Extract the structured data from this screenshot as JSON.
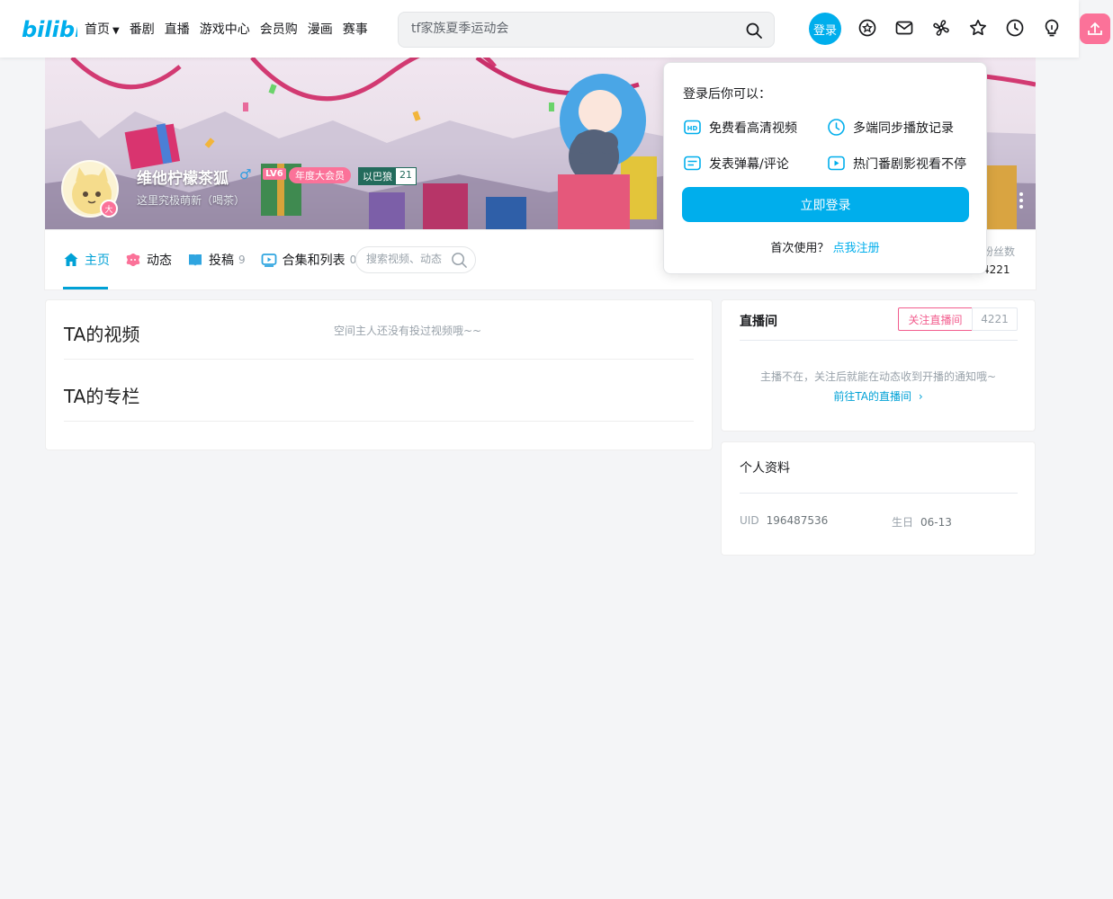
{
  "header": {
    "logo_text": "bilibili",
    "nav": [
      "首页",
      "番剧",
      "直播",
      "游戏中心",
      "会员购",
      "漫画",
      "赛事"
    ],
    "search_placeholder": "tf家族夏季运动会",
    "login_label": "登录"
  },
  "user": {
    "name": "维他柠檬茶狐",
    "gender_symbol": "♂",
    "level": "LV6",
    "vip": "年度大会员",
    "medal_name": "以巴狼",
    "medal_level": "21",
    "sign": "这里究极萌新（喝茶）",
    "avatar_badge": "大"
  },
  "tabs": [
    {
      "label": "主页",
      "count": ""
    },
    {
      "label": "动态",
      "count": ""
    },
    {
      "label": "投稿",
      "count": "9"
    },
    {
      "label": "合集和列表",
      "count": "0"
    }
  ],
  "space_search_placeholder": "搜索视频、动态",
  "fans": {
    "label": "粉丝数",
    "value": "4221"
  },
  "videos": {
    "title": "TA的视频",
    "empty": "空间主人还没有投过视频哦~~"
  },
  "column": {
    "title": "TA的专栏"
  },
  "live": {
    "title": "直播间",
    "follow": "关注直播间",
    "count": "4221",
    "message": "主播不在，关注后就能在动态收到开播的通知哦~",
    "link": "前往TA的直播间"
  },
  "profile": {
    "title": "个人资料",
    "uid_label": "UID",
    "uid": "196487536",
    "birthday_label": "生日",
    "birthday": "06-13"
  },
  "popup": {
    "title": "登录后你可以：",
    "features": [
      "免费看高清视频",
      "多端同步播放记录",
      "发表弹幕/评论",
      "热门番剧影视看不停"
    ],
    "button": "立即登录",
    "register_prompt": "首次使用？",
    "register_link": "点我注册"
  },
  "colors": {
    "accent": "#00aeec",
    "pink": "#fb7299",
    "tab_active": "#00a1d6"
  }
}
